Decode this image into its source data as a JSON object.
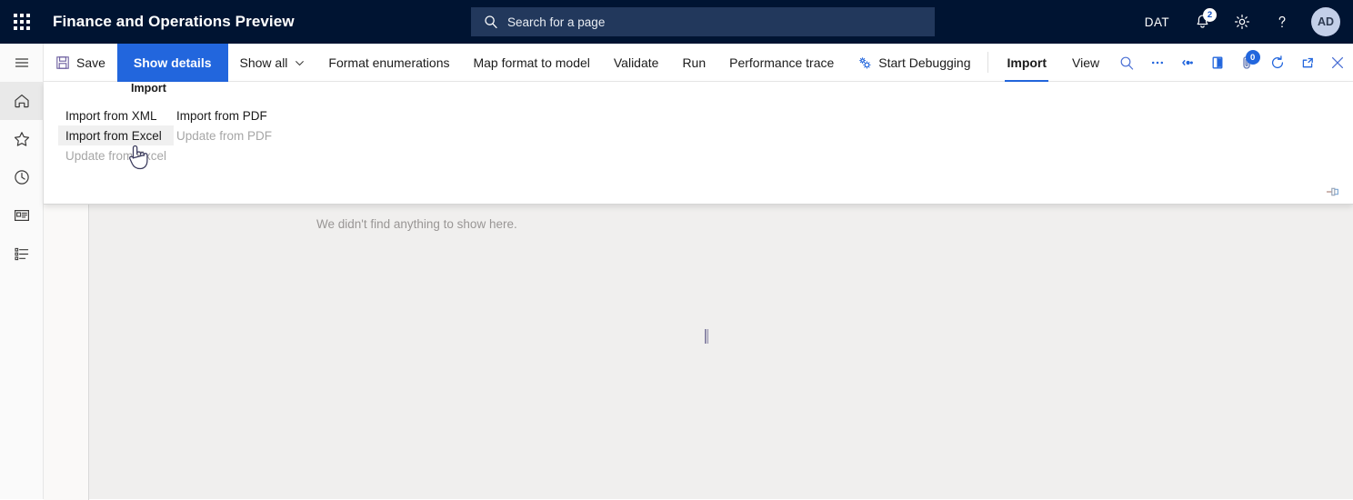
{
  "header": {
    "title": "Finance and Operations Preview",
    "waffle_icon": "app-launcher-icon",
    "search": {
      "placeholder": "Search for a page",
      "icon": "search-icon"
    },
    "company": "DAT",
    "notifications": {
      "icon": "bell-icon",
      "count": "2"
    },
    "settings_icon": "gear-icon",
    "help_icon": "question-mark-icon",
    "avatar": {
      "initials": "AD"
    }
  },
  "nav_rail": {
    "items": [
      {
        "name": "menu-toggle",
        "icon": "hamburger-icon",
        "active": false
      },
      {
        "name": "home",
        "icon": "home-icon",
        "active": true
      },
      {
        "name": "favorites",
        "icon": "star-icon",
        "active": false
      },
      {
        "name": "recent",
        "icon": "clock-icon",
        "active": false
      },
      {
        "name": "workspaces",
        "icon": "workspace-card-icon",
        "active": false
      },
      {
        "name": "modules",
        "icon": "list-icon",
        "active": false
      }
    ]
  },
  "command_bar": {
    "save_label": "Save",
    "save_icon": "floppy-disk-icon",
    "show_details_label": "Show details",
    "show_all_label": "Show all",
    "show_all_caret": "chevron-down-icon",
    "format_enumerations_label": "Format enumerations",
    "map_format_to_model_label": "Map format to model",
    "validate_label": "Validate",
    "run_label": "Run",
    "performance_trace_label": "Performance trace",
    "start_debugging_label": "Start Debugging",
    "start_debugging_icon": "gears-icon",
    "tabs": [
      {
        "label": "Import",
        "active": true
      },
      {
        "label": "View",
        "active": false
      }
    ],
    "right_icons": [
      {
        "name": "search-icon",
        "badge": null
      },
      {
        "name": "overflow-ellipsis-icon",
        "badge": null
      },
      {
        "name": "link-share-icon",
        "badge": null
      },
      {
        "name": "open-in-new-pane-icon",
        "badge": null
      },
      {
        "name": "attachments-icon",
        "badge": "0"
      },
      {
        "name": "refresh-icon",
        "badge": null
      },
      {
        "name": "popout-icon",
        "badge": null
      },
      {
        "name": "close-icon",
        "badge": null
      }
    ]
  },
  "flyout": {
    "group_title": "Import",
    "column_1": [
      {
        "label": "Import from XML",
        "state": "normal"
      },
      {
        "label": "Import from Excel",
        "state": "hovered"
      },
      {
        "label": "Update from Excel",
        "state": "disabled"
      }
    ],
    "column_2": [
      {
        "label": "Import from PDF",
        "state": "normal"
      },
      {
        "label": "Update from PDF",
        "state": "disabled"
      }
    ],
    "pin_icon": "pin-icon"
  },
  "content": {
    "empty_message": "We didn't find anything to show here.",
    "splitter": "vertical-splitter-handle"
  },
  "cursor": {
    "type": "pointing-hand-cursor"
  },
  "colors": {
    "header_bg": "#001432",
    "search_bg": "#22385c",
    "accent_blue": "#2266dd",
    "content_bg": "#f0efee",
    "rail_bg": "#fafafa"
  }
}
